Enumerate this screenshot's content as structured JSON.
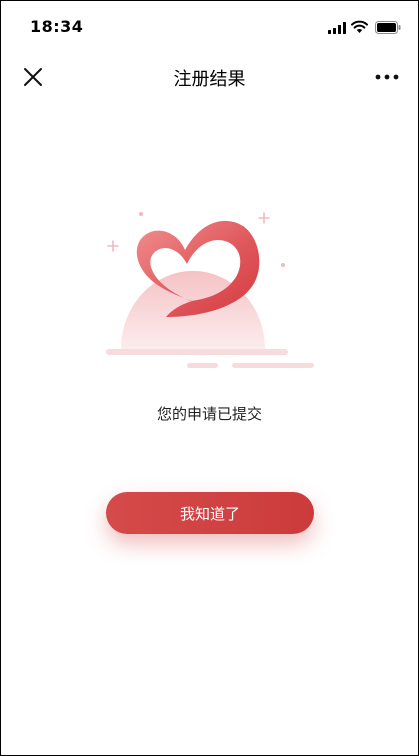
{
  "status_bar": {
    "time": "18:34"
  },
  "nav": {
    "title": "注册结果",
    "close_icon": "close-icon",
    "more_icon": "more-horizontal-icon"
  },
  "result": {
    "message": "您的申请已提交",
    "illustration_icon": "heart-illustration",
    "accent_color": "#d44546"
  },
  "actions": {
    "confirm_label": "我知道了"
  }
}
